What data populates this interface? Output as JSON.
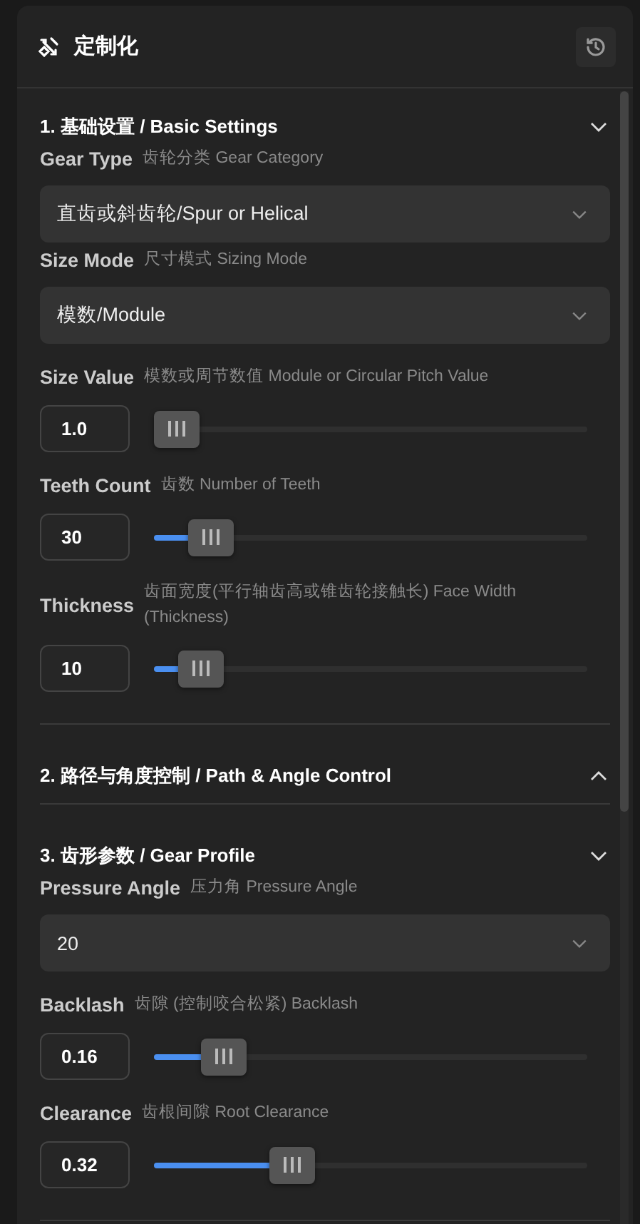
{
  "header": {
    "title": "定制化"
  },
  "sections": [
    {
      "title": "1. 基础设置 / Basic Settings",
      "expanded": true,
      "fields": [
        {
          "kind": "select",
          "label": "Gear Type",
          "hint": "齿轮分类 Gear Category",
          "value": "直齿或斜齿轮/Spur or Helical"
        },
        {
          "kind": "select",
          "label": "Size Mode",
          "hint": "尺寸模式 Sizing Mode",
          "value": "模数/Module"
        },
        {
          "kind": "slider",
          "label": "Size Value",
          "hint": "模数或周节数值 Module or Circular Pitch Value",
          "value": "1.0",
          "level": 0.053
        },
        {
          "kind": "slider",
          "label": "Teeth Count",
          "hint": "齿数 Number of Teeth",
          "value": "30",
          "level": 0.13
        },
        {
          "kind": "slider",
          "label": "Thickness",
          "hint": "齿面宽度(平行轴齿高或锥齿轮接触长) Face Width (Thickness)",
          "value": "10",
          "level": 0.11
        }
      ]
    },
    {
      "title": "2. 路径与角度控制 / Path & Angle Control",
      "expanded": false
    },
    {
      "title": "3. 齿形参数 / Gear Profile",
      "expanded": true,
      "fields": [
        {
          "kind": "select",
          "label": "Pressure Angle",
          "hint": "压力角 Pressure Angle",
          "value": "20"
        },
        {
          "kind": "slider",
          "label": "Backlash",
          "hint": "齿隙 (控制咬合松紧) Backlash",
          "value": "0.16",
          "level": 0.16
        },
        {
          "kind": "slider",
          "label": "Clearance",
          "hint": "齿根间隙 Root Clearance",
          "value": "0.32",
          "level": 0.32
        }
      ]
    }
  ]
}
